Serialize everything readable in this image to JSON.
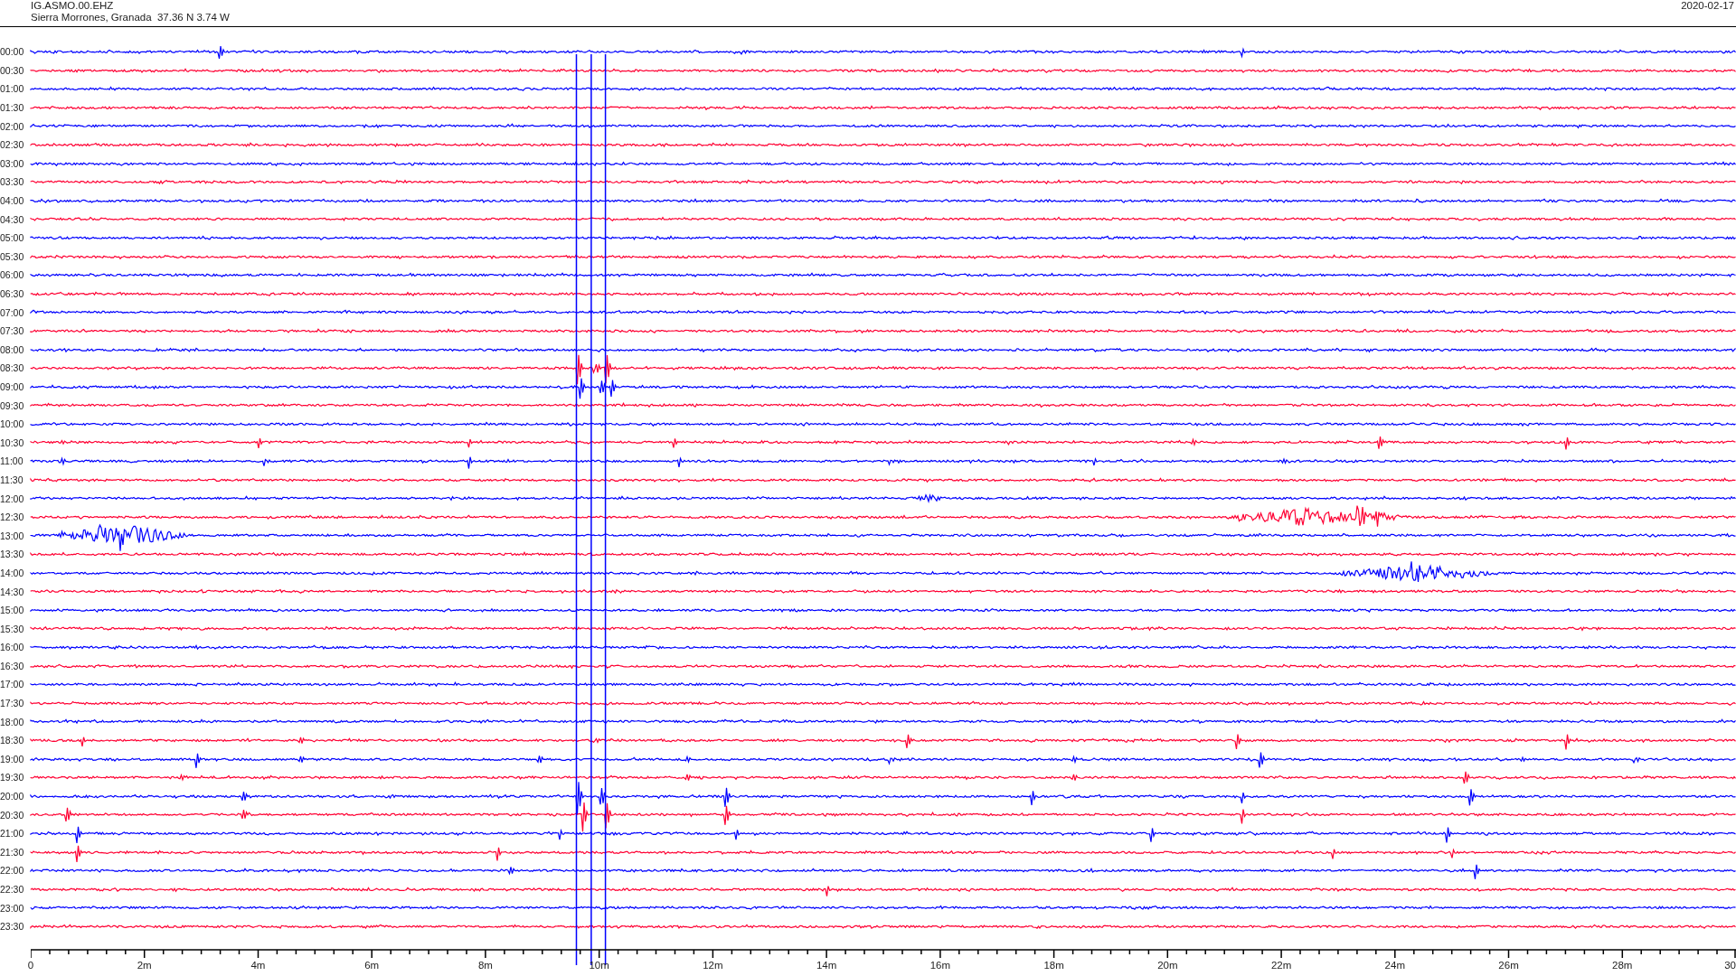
{
  "header": {
    "station": "IG.ASMO.00.EHZ",
    "location": "Sierra Morrones, Granada  37.36 N 3.74 W",
    "date": "2020-02-17"
  },
  "traces": [
    {
      "time": "00:00",
      "color": "#0000ff"
    },
    {
      "time": "00:30",
      "color": "#ff0033"
    },
    {
      "time": "01:00",
      "color": "#0000ff"
    },
    {
      "time": "01:30",
      "color": "#ff0033"
    },
    {
      "time": "02:00",
      "color": "#0000ff"
    },
    {
      "time": "02:30",
      "color": "#ff0033"
    },
    {
      "time": "03:00",
      "color": "#0000ff"
    },
    {
      "time": "03:30",
      "color": "#ff0033"
    },
    {
      "time": "04:00",
      "color": "#0000ff"
    },
    {
      "time": "04:30",
      "color": "#ff0033"
    },
    {
      "time": "05:00",
      "color": "#0000ff"
    },
    {
      "time": "05:30",
      "color": "#ff0033"
    },
    {
      "time": "06:00",
      "color": "#0000ff"
    },
    {
      "time": "06:30",
      "color": "#ff0033"
    },
    {
      "time": "07:00",
      "color": "#0000ff"
    },
    {
      "time": "07:30",
      "color": "#ff0033"
    },
    {
      "time": "08:00",
      "color": "#0000ff"
    },
    {
      "time": "08:30",
      "color": "#ff0033"
    },
    {
      "time": "09:00",
      "color": "#0000ff"
    },
    {
      "time": "09:30",
      "color": "#ff0033"
    },
    {
      "time": "10:00",
      "color": "#0000ff"
    },
    {
      "time": "10:30",
      "color": "#ff0033"
    },
    {
      "time": "11:00",
      "color": "#0000ff"
    },
    {
      "time": "11:30",
      "color": "#ff0033"
    },
    {
      "time": "12:00",
      "color": "#0000ff"
    },
    {
      "time": "12:30",
      "color": "#ff0033"
    },
    {
      "time": "13:00",
      "color": "#0000ff"
    },
    {
      "time": "13:30",
      "color": "#ff0033"
    },
    {
      "time": "14:00",
      "color": "#0000ff"
    },
    {
      "time": "14:30",
      "color": "#ff0033"
    },
    {
      "time": "15:00",
      "color": "#0000ff"
    },
    {
      "time": "15:30",
      "color": "#ff0033"
    },
    {
      "time": "16:00",
      "color": "#0000ff"
    },
    {
      "time": "16:30",
      "color": "#ff0033"
    },
    {
      "time": "17:00",
      "color": "#0000ff"
    },
    {
      "time": "17:30",
      "color": "#ff0033"
    },
    {
      "time": "18:00",
      "color": "#0000ff"
    },
    {
      "time": "18:30",
      "color": "#ff0033"
    },
    {
      "time": "19:00",
      "color": "#0000ff"
    },
    {
      "time": "19:30",
      "color": "#ff0033"
    },
    {
      "time": "20:00",
      "color": "#0000ff"
    },
    {
      "time": "20:30",
      "color": "#ff0033"
    },
    {
      "time": "21:00",
      "color": "#0000ff"
    },
    {
      "time": "21:30",
      "color": "#ff0033"
    },
    {
      "time": "22:00",
      "color": "#0000ff"
    },
    {
      "time": "22:30",
      "color": "#ff0033"
    },
    {
      "time": "23:00",
      "color": "#0000ff"
    },
    {
      "time": "23:30",
      "color": "#ff0033"
    }
  ],
  "axis": {
    "ticks": [
      "0",
      "2m",
      "4m",
      "6m",
      "8m",
      "10m",
      "12m",
      "14m",
      "16m",
      "18m",
      "20m",
      "22m",
      "24m",
      "26m",
      "28m",
      "30"
    ]
  }
}
